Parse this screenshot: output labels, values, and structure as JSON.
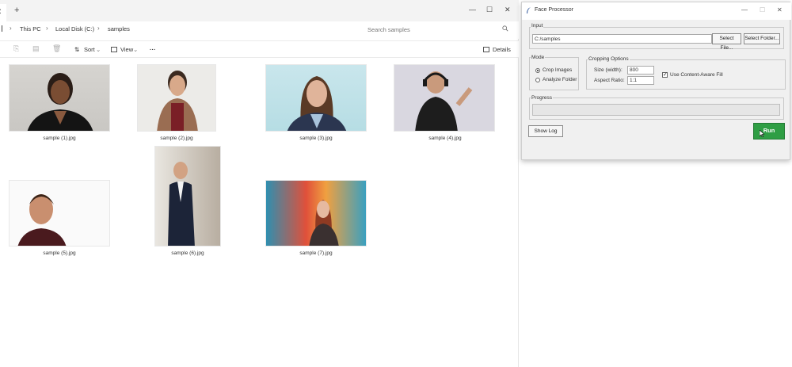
{
  "explorer": {
    "new_tab_symbol": "+",
    "window_controls": {
      "minimize": "—",
      "maximize": "☐",
      "close": "✕"
    },
    "breadcrumb": [
      "This PC",
      "Local Disk (C:)",
      "samples"
    ],
    "search_placeholder": "Search samples",
    "commands": {
      "sort": "Sort",
      "view": "View",
      "more": "···",
      "details": "Details"
    },
    "files": [
      {
        "name": "sample (1).jpg"
      },
      {
        "name": "sample (2).jpg"
      },
      {
        "name": "sample (3).jpg"
      },
      {
        "name": "sample (4).jpg"
      },
      {
        "name": "sample (5).jpg"
      },
      {
        "name": "sample (6).jpg"
      },
      {
        "name": "sample (7).jpg"
      }
    ]
  },
  "face_processor": {
    "title": "Face Processor",
    "input": {
      "label": "Input",
      "path_value": "C:/samples",
      "select_file": "Select File...",
      "select_folder": "Select Folder..."
    },
    "mode": {
      "label": "Mode",
      "options": [
        "Crop Images",
        "Analyze Folder"
      ],
      "selected": "Crop Images"
    },
    "cropping": {
      "label": "Cropping Options",
      "size_label": "Size (width):",
      "size_value": "800",
      "ratio_label": "Aspect Ratio:",
      "ratio_value": "1:1",
      "content_aware_label": "Use Content-Aware Fill",
      "content_aware_checked": true
    },
    "progress": {
      "label": "Progress",
      "value": 0
    },
    "show_log": "Show Log",
    "run": "Run",
    "colors": {
      "run_button": "#2f9e44"
    }
  }
}
